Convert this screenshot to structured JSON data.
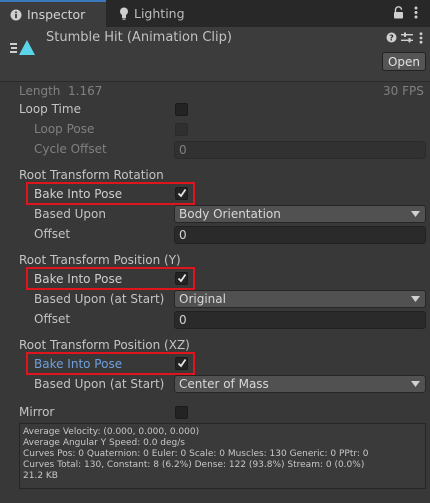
{
  "tabs": [
    {
      "label": "Inspector",
      "icon": "info-icon"
    },
    {
      "label": "Lighting",
      "icon": "lightbulb-icon"
    }
  ],
  "tab_icons": [
    "lock-icon",
    "more-icon"
  ],
  "header": {
    "title": "Stumble Hit (Animation Clip)",
    "icons": [
      "help-icon",
      "settings-icon",
      "more-icon"
    ],
    "open_label": "Open"
  },
  "clip": {
    "length_label": "Length",
    "length_value": "1.167",
    "fps": "30 FPS",
    "loop_time_label": "Loop Time",
    "loop_time": false,
    "loop_pose_label": "Loop Pose",
    "loop_pose": false,
    "cycle_offset_label": "Cycle Offset",
    "cycle_offset": "0"
  },
  "root_rotation": {
    "title": "Root Transform Rotation",
    "bake_label": "Bake Into Pose",
    "bake": true,
    "based_upon_label": "Based Upon",
    "based_upon": "Body Orientation",
    "offset_label": "Offset",
    "offset": "0"
  },
  "root_position_y": {
    "title": "Root Transform Position (Y)",
    "bake_label": "Bake Into Pose",
    "bake": true,
    "based_upon_label": "Based Upon (at Start)",
    "based_upon": "Original",
    "offset_label": "Offset",
    "offset": "0"
  },
  "root_position_xz": {
    "title": "Root Transform Position (XZ)",
    "bake_label": "Bake Into Pose",
    "bake": true,
    "based_upon_label": "Based Upon (at Start)",
    "based_upon": "Center of Mass"
  },
  "mirror": {
    "label": "Mirror",
    "checked": false
  },
  "stats": [
    "Average Velocity: (0.000, 0.000, 0.000)",
    "Average Angular Y Speed: 0.0 deg/s",
    "Curves Pos: 0 Quaternion: 0 Euler: 0 Scale: 0 Muscles: 130 Generic: 0 PPtr: 0",
    "Curves Total: 130, Constant: 8 (6.2%) Dense: 122 (93.8%) Stream: 0 (0.0%)",
    "21.2 KB"
  ],
  "colors": {
    "highlight": "#e0141c",
    "accent_tab": "#3a79bb",
    "active_label": "#6fa0dd",
    "clip_icon": "#5ad6ea"
  }
}
